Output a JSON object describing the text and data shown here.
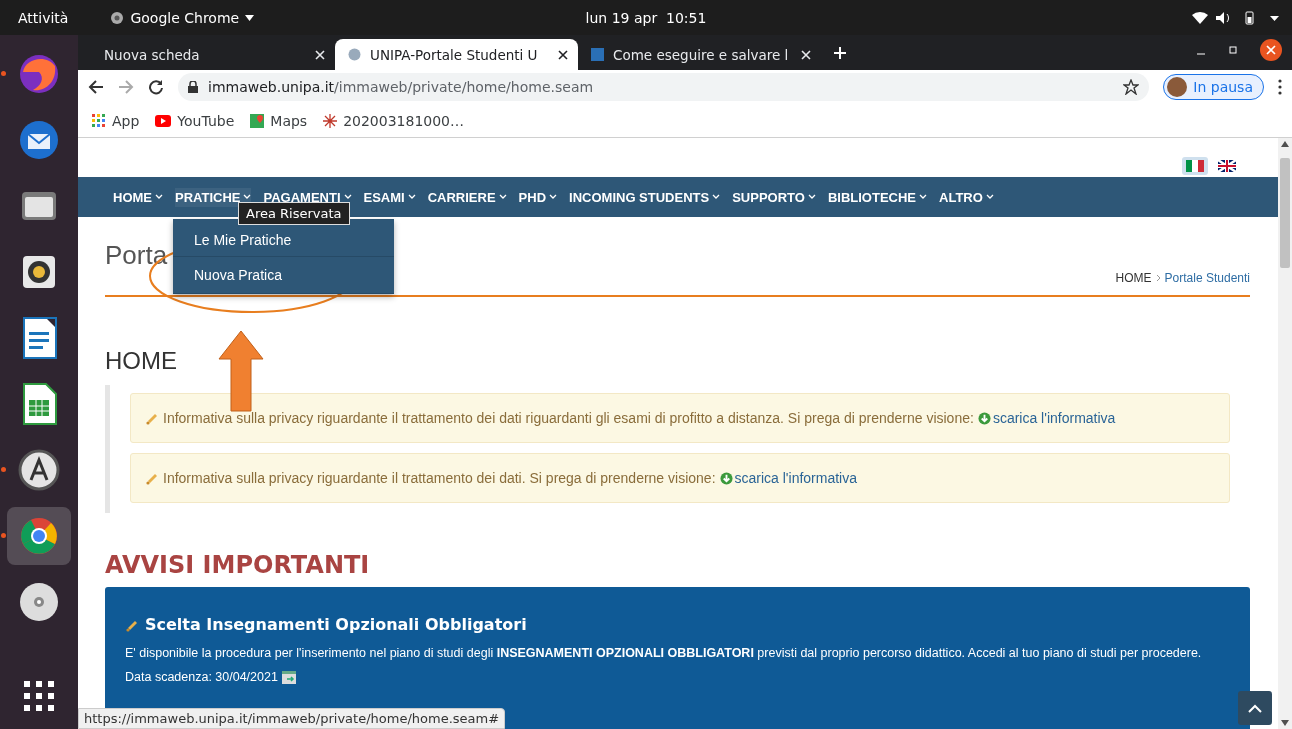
{
  "system_bar": {
    "activities": "Attività",
    "app_menu": "Google Chrome",
    "clock": "lun 19 apr  10:51"
  },
  "dock": [
    {
      "running": true,
      "selected": false
    },
    {
      "running": false,
      "selected": false
    },
    {
      "running": false,
      "selected": false
    },
    {
      "running": false,
      "selected": false
    },
    {
      "running": false,
      "selected": false
    },
    {
      "running": false,
      "selected": false
    },
    {
      "running": true,
      "selected": false
    },
    {
      "running": true,
      "selected": true
    },
    {
      "running": false,
      "selected": false
    }
  ],
  "tabs": [
    {
      "title": "Nuova scheda",
      "selected": false
    },
    {
      "title": "UNIPA-Portale Studenti U",
      "selected": true
    },
    {
      "title": "Come eseguire e salvare l",
      "selected": false
    }
  ],
  "address": {
    "domain": "immaweb.unipa.it",
    "path": "/immaweb/private/home/home.seam"
  },
  "profile": "In pausa",
  "bookmarks": [
    "App",
    "YouTube",
    "Maps",
    "202003181000…"
  ],
  "nav": [
    {
      "label": "HOME",
      "open": false
    },
    {
      "label": "PRATICHE",
      "open": true
    },
    {
      "label": "PAGAMENTI",
      "open": false
    },
    {
      "label": "ESAMI",
      "open": false
    },
    {
      "label": "CARRIERE",
      "open": false
    },
    {
      "label": "PHD",
      "open": false
    },
    {
      "label": "INCOMING STUDENTS",
      "open": false
    },
    {
      "label": "SUPPORTO",
      "open": false
    },
    {
      "label": "BIBLIOTECHE",
      "open": false
    },
    {
      "label": "ALTRO",
      "open": false
    }
  ],
  "dropdown": [
    "Le Mie Pratiche",
    "Nuova Pratica"
  ],
  "tooltip": "Area Riservata",
  "page_title": "Porta",
  "breadcrumb": [
    "HOME",
    "Portale Studenti"
  ],
  "section_title": "HOME",
  "notices": [
    {
      "text": "Informativa sulla privacy riguardante il trattamento dei dati riguardanti gli esami di profitto a distanza. Si prega di prenderne visione:",
      "link": "scarica l'informativa"
    },
    {
      "text": "Informativa sulla privacy riguardante il trattamento dei dati. Si prega di prenderne visione:",
      "link": "scarica l'informativa"
    }
  ],
  "important_title": "AVVISI IMPORTANTI",
  "card": {
    "title": "Scelta Insegnamenti Opzionali Obbligatori",
    "body": "E' disponibile la procedura per l'inserimento nel piano di studi degli **INSEGNAMENTI OPZIONALI OBBLIGATORI** previsti dal proprio percorso didattico. Accedi al tuo piano di studi per procedere.",
    "deadline": "Data scadenza: 30/04/2021"
  },
  "status_url": "https://immaweb.unipa.it/immaweb/private/home/home.seam#"
}
